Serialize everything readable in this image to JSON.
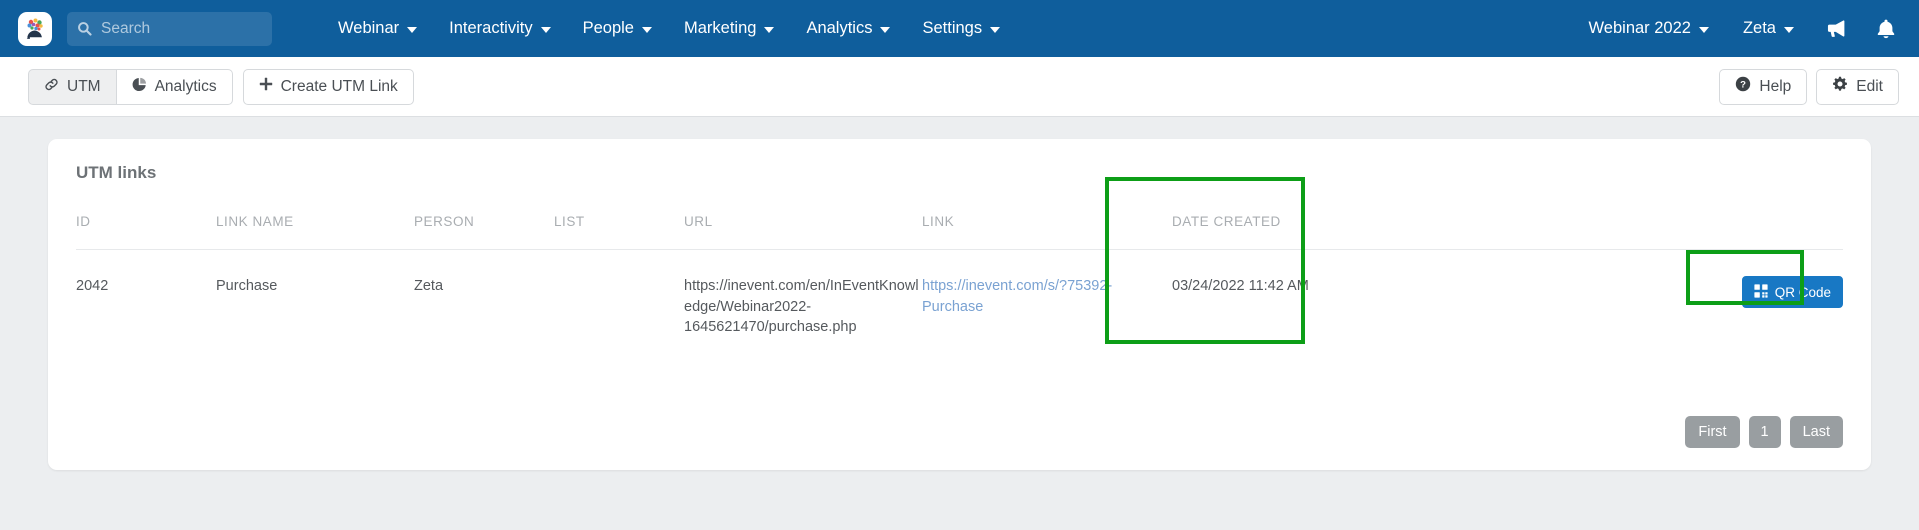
{
  "navbar": {
    "logo_name": "inevent-logo",
    "search": {
      "placeholder": "Search",
      "value": "",
      "icon": "search-icon"
    },
    "menu": [
      {
        "label": "Webinar"
      },
      {
        "label": "Interactivity"
      },
      {
        "label": "People"
      },
      {
        "label": "Marketing"
      },
      {
        "label": "Analytics"
      },
      {
        "label": "Settings"
      }
    ],
    "right": [
      {
        "label": "Webinar 2022"
      },
      {
        "label": "Zeta"
      }
    ],
    "icons": [
      {
        "name": "megaphone-icon"
      },
      {
        "name": "bell-icon"
      }
    ],
    "bg_color": "#0f5e9c"
  },
  "toolbar": {
    "tabs": [
      {
        "label": "UTM",
        "icon": "link-icon",
        "active": true
      },
      {
        "label": "Analytics",
        "icon": "pie-chart-icon",
        "active": false
      }
    ],
    "create_label": "Create UTM Link",
    "create_icon": "plus-icon",
    "help_label": "Help",
    "help_icon": "question-circle-icon",
    "edit_label": "Edit",
    "edit_icon": "gear-icon"
  },
  "card": {
    "title": "UTM links",
    "table": {
      "headers": [
        "ID",
        "LINK NAME",
        "PERSON",
        "LIST",
        "URL",
        "LINK",
        "DATE CREATED",
        ""
      ],
      "rows": [
        {
          "id": "2042",
          "link_name": "Purchase",
          "person": "Zeta",
          "list": "",
          "url": "https://inevent.com/en/InEventKnowledge/Webinar2022-1645621470/purchase.php",
          "link": "https://inevent.com/s/?75392-Purchase",
          "date_created": "03/24/2022 11:42 AM",
          "action_label": "QR Code",
          "action_icon": "qr-code-icon"
        }
      ]
    },
    "pagination": {
      "first_label": "First",
      "current_page": "1",
      "last_label": "Last"
    }
  },
  "annotations": {
    "highlight_color": "#0d9e17",
    "highlighted_regions": [
      "link-column",
      "qr-code-button"
    ]
  },
  "colors": {
    "navbar": "#0f5e9c",
    "page_bg": "#eceef0",
    "card_bg": "#ffffff",
    "link_blue": "#7aa2d2",
    "primary_button": "#1878c4",
    "pagination_button": "#999ea1",
    "highlight_green": "#0d9e17"
  }
}
